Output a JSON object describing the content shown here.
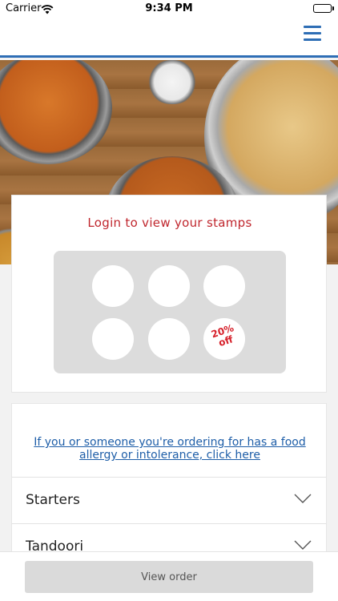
{
  "status_bar": {
    "carrier": "Carrier",
    "time": "9:34 PM",
    "wifi_icon": "wifi-icon",
    "battery_icon": "battery-icon"
  },
  "header": {
    "menu_icon": "hamburger-menu-icon",
    "accent_color": "#2e6eb5"
  },
  "hero": {
    "image": "indian-food-dishes-photo"
  },
  "stamp_card": {
    "title": "Login to view your stamps",
    "title_color": "#c0262d",
    "stamps": [
      "",
      "",
      "",
      "",
      ""
    ],
    "reward_line1": "20%",
    "reward_line2": "off",
    "reward_color": "#d6202a"
  },
  "menu": {
    "allergy_link": "If you or someone you're ordering for has a food allergy or intolerance, click here",
    "link_color": "#1e5ea8",
    "categories": [
      {
        "label": "Starters",
        "icon": "chevron-down-icon"
      },
      {
        "label": "Tandoori",
        "icon": "chevron-down-icon"
      }
    ]
  },
  "footer": {
    "view_order_label": "View order"
  }
}
